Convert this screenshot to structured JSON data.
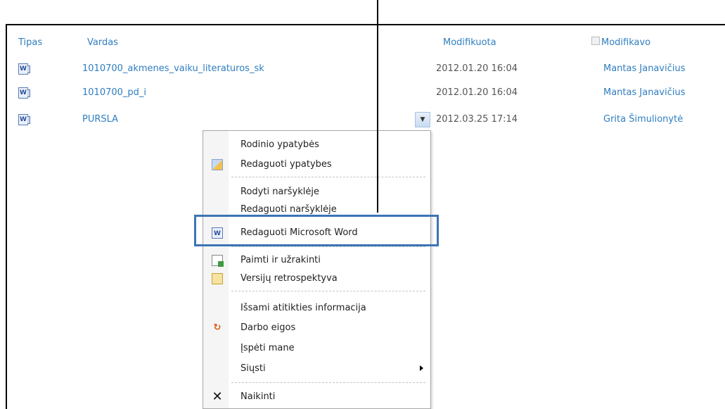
{
  "columns": {
    "type": "Tipas",
    "name": "Vardas",
    "modified": "Modifikuota",
    "modified_by": "Modifikavo"
  },
  "rows": [
    {
      "icon": "word-document-icon",
      "name": "1010700_akmenes_vaiku_literaturos_sk",
      "modified": "2012.01.20 16:04",
      "modified_by": "Mantas Janavičius"
    },
    {
      "icon": "word-document-icon",
      "name": "1010700_pd_i",
      "modified": "2012.01.20 16:04",
      "modified_by": "Mantas Janavičius"
    },
    {
      "icon": "word-document-icon",
      "name": "PURSLA",
      "modified": "2012.03.25 17:14",
      "modified_by": "Grita Šimulionytė"
    }
  ],
  "context_menu": {
    "items": [
      {
        "label": "Rodinio ypatybės",
        "icon": ""
      },
      {
        "label": "Redaguoti ypatybes",
        "icon": "edit-properties-icon"
      },
      {
        "label": "Rodyti naršyklėje",
        "icon": ""
      },
      {
        "label": "Redaguoti naršyklėje",
        "icon": ""
      },
      {
        "label": "Redaguoti Microsoft Word",
        "icon": "word-document-icon"
      },
      {
        "label": "Paimti ir užrakinti",
        "icon": "check-out-icon"
      },
      {
        "label": "Versijų retrospektyva",
        "icon": "version-history-icon"
      },
      {
        "label": "Išsami atitikties informacija",
        "icon": ""
      },
      {
        "label": "Darbo eigos",
        "icon": "workflow-icon"
      },
      {
        "label": "Įspėti mane",
        "icon": ""
      },
      {
        "label": "Siųsti",
        "icon": "submenu-arrow-icon"
      },
      {
        "label": "Naikinti",
        "icon": "delete-icon"
      }
    ]
  },
  "colors": {
    "link": "#2f7ec1",
    "highlight": "#3c74b4"
  }
}
